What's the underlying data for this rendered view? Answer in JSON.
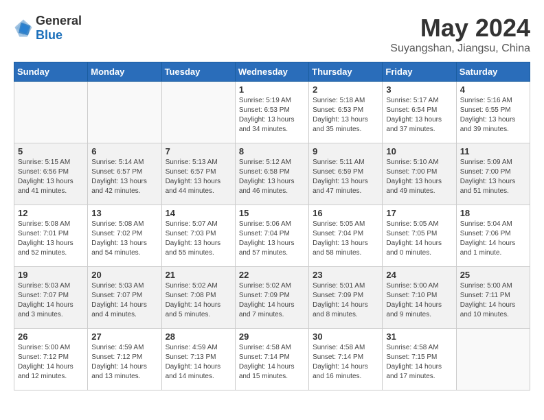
{
  "header": {
    "logo_general": "General",
    "logo_blue": "Blue",
    "month": "May 2024",
    "location": "Suyangshan, Jiangsu, China"
  },
  "weekdays": [
    "Sunday",
    "Monday",
    "Tuesday",
    "Wednesday",
    "Thursday",
    "Friday",
    "Saturday"
  ],
  "weeks": [
    [
      {
        "day": "",
        "info": ""
      },
      {
        "day": "",
        "info": ""
      },
      {
        "day": "",
        "info": ""
      },
      {
        "day": "1",
        "info": "Sunrise: 5:19 AM\nSunset: 6:53 PM\nDaylight: 13 hours\nand 34 minutes."
      },
      {
        "day": "2",
        "info": "Sunrise: 5:18 AM\nSunset: 6:53 PM\nDaylight: 13 hours\nand 35 minutes."
      },
      {
        "day": "3",
        "info": "Sunrise: 5:17 AM\nSunset: 6:54 PM\nDaylight: 13 hours\nand 37 minutes."
      },
      {
        "day": "4",
        "info": "Sunrise: 5:16 AM\nSunset: 6:55 PM\nDaylight: 13 hours\nand 39 minutes."
      }
    ],
    [
      {
        "day": "5",
        "info": "Sunrise: 5:15 AM\nSunset: 6:56 PM\nDaylight: 13 hours\nand 41 minutes."
      },
      {
        "day": "6",
        "info": "Sunrise: 5:14 AM\nSunset: 6:57 PM\nDaylight: 13 hours\nand 42 minutes."
      },
      {
        "day": "7",
        "info": "Sunrise: 5:13 AM\nSunset: 6:57 PM\nDaylight: 13 hours\nand 44 minutes."
      },
      {
        "day": "8",
        "info": "Sunrise: 5:12 AM\nSunset: 6:58 PM\nDaylight: 13 hours\nand 46 minutes."
      },
      {
        "day": "9",
        "info": "Sunrise: 5:11 AM\nSunset: 6:59 PM\nDaylight: 13 hours\nand 47 minutes."
      },
      {
        "day": "10",
        "info": "Sunrise: 5:10 AM\nSunset: 7:00 PM\nDaylight: 13 hours\nand 49 minutes."
      },
      {
        "day": "11",
        "info": "Sunrise: 5:09 AM\nSunset: 7:00 PM\nDaylight: 13 hours\nand 51 minutes."
      }
    ],
    [
      {
        "day": "12",
        "info": "Sunrise: 5:08 AM\nSunset: 7:01 PM\nDaylight: 13 hours\nand 52 minutes."
      },
      {
        "day": "13",
        "info": "Sunrise: 5:08 AM\nSunset: 7:02 PM\nDaylight: 13 hours\nand 54 minutes."
      },
      {
        "day": "14",
        "info": "Sunrise: 5:07 AM\nSunset: 7:03 PM\nDaylight: 13 hours\nand 55 minutes."
      },
      {
        "day": "15",
        "info": "Sunrise: 5:06 AM\nSunset: 7:04 PM\nDaylight: 13 hours\nand 57 minutes."
      },
      {
        "day": "16",
        "info": "Sunrise: 5:05 AM\nSunset: 7:04 PM\nDaylight: 13 hours\nand 58 minutes."
      },
      {
        "day": "17",
        "info": "Sunrise: 5:05 AM\nSunset: 7:05 PM\nDaylight: 14 hours\nand 0 minutes."
      },
      {
        "day": "18",
        "info": "Sunrise: 5:04 AM\nSunset: 7:06 PM\nDaylight: 14 hours\nand 1 minute."
      }
    ],
    [
      {
        "day": "19",
        "info": "Sunrise: 5:03 AM\nSunset: 7:07 PM\nDaylight: 14 hours\nand 3 minutes."
      },
      {
        "day": "20",
        "info": "Sunrise: 5:03 AM\nSunset: 7:07 PM\nDaylight: 14 hours\nand 4 minutes."
      },
      {
        "day": "21",
        "info": "Sunrise: 5:02 AM\nSunset: 7:08 PM\nDaylight: 14 hours\nand 5 minutes."
      },
      {
        "day": "22",
        "info": "Sunrise: 5:02 AM\nSunset: 7:09 PM\nDaylight: 14 hours\nand 7 minutes."
      },
      {
        "day": "23",
        "info": "Sunrise: 5:01 AM\nSunset: 7:09 PM\nDaylight: 14 hours\nand 8 minutes."
      },
      {
        "day": "24",
        "info": "Sunrise: 5:00 AM\nSunset: 7:10 PM\nDaylight: 14 hours\nand 9 minutes."
      },
      {
        "day": "25",
        "info": "Sunrise: 5:00 AM\nSunset: 7:11 PM\nDaylight: 14 hours\nand 10 minutes."
      }
    ],
    [
      {
        "day": "26",
        "info": "Sunrise: 5:00 AM\nSunset: 7:12 PM\nDaylight: 14 hours\nand 12 minutes."
      },
      {
        "day": "27",
        "info": "Sunrise: 4:59 AM\nSunset: 7:12 PM\nDaylight: 14 hours\nand 13 minutes."
      },
      {
        "day": "28",
        "info": "Sunrise: 4:59 AM\nSunset: 7:13 PM\nDaylight: 14 hours\nand 14 minutes."
      },
      {
        "day": "29",
        "info": "Sunrise: 4:58 AM\nSunset: 7:14 PM\nDaylight: 14 hours\nand 15 minutes."
      },
      {
        "day": "30",
        "info": "Sunrise: 4:58 AM\nSunset: 7:14 PM\nDaylight: 14 hours\nand 16 minutes."
      },
      {
        "day": "31",
        "info": "Sunrise: 4:58 AM\nSunset: 7:15 PM\nDaylight: 14 hours\nand 17 minutes."
      },
      {
        "day": "",
        "info": ""
      }
    ]
  ]
}
